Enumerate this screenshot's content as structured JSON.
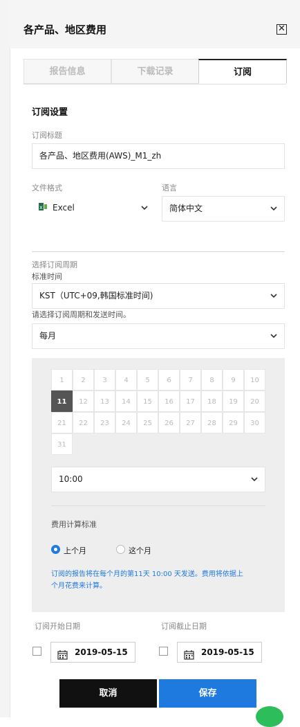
{
  "header": {
    "title": "各产品、地区费用",
    "close_label": "✕"
  },
  "tabs": [
    {
      "label": "报告信息"
    },
    {
      "label": "下载记录"
    },
    {
      "label": "订阅"
    }
  ],
  "subscription": {
    "section_title": "订阅设置",
    "subject_label": "订阅标题",
    "subject_value": "各产品、地区费用(AWS)_M1_zh",
    "format_label": "文件格式",
    "format_value": "Excel",
    "language_label": "语言",
    "language_value": "简体中文",
    "period_section_label": "选择订阅周期",
    "timezone_label": "标准时间",
    "timezone_value": "KST（UTC+09,韩国标准时间)",
    "cycle_prompt": "请选择订阅周期和发送时间。",
    "cycle_value": "每月",
    "days": [
      "1",
      "2",
      "3",
      "4",
      "5",
      "6",
      "7",
      "8",
      "9",
      "10",
      "11",
      "12",
      "13",
      "14",
      "15",
      "16",
      "17",
      "18",
      "19",
      "20",
      "21",
      "22",
      "23",
      "24",
      "25",
      "26",
      "27",
      "28",
      "29",
      "30",
      "31"
    ],
    "selected_day": "11",
    "time_value": "10:00",
    "cost_basis_label": "费用计算标准",
    "radio_last_month": "上个月",
    "radio_this_month": "这个月",
    "info_line1": "订阅的报告将在每个月的第11天 10:00 天发送。费用将依据上",
    "info_line2": "个月花费来计算。",
    "start_date_label": "订阅开始日期",
    "end_date_label": "订阅截止日期",
    "start_date": "2019-05-15",
    "end_date": "2019-05-15"
  },
  "buttons": {
    "cancel": "取消",
    "save": "保存"
  },
  "colors": {
    "accent": "#1f7ae0",
    "cancel_bg": "#111111",
    "excel_green": "#1e7145"
  }
}
